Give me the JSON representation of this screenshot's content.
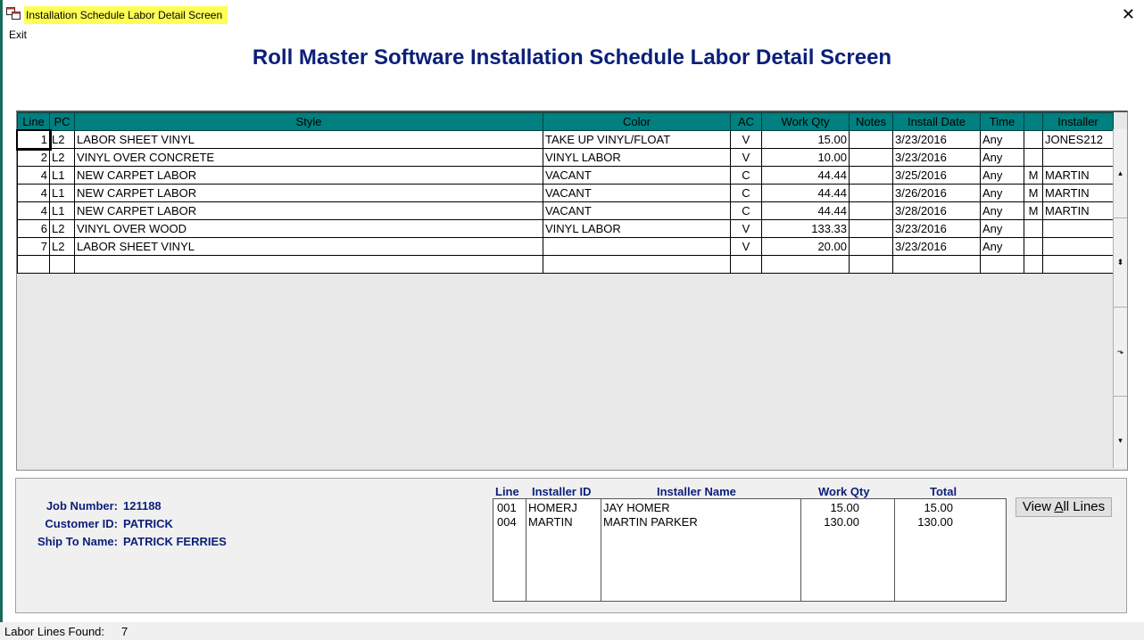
{
  "window": {
    "title": "Installation Schedule Labor Detail Screen",
    "close_glyph": "✕",
    "icon": "app-window-icon"
  },
  "menu": {
    "exit_label": "Exit"
  },
  "heading": "Roll Master Software Installation Schedule Labor Detail Screen",
  "grid": {
    "columns": [
      "Line",
      "PC",
      "Style",
      "Color",
      "AC",
      "Work Qty",
      "Notes",
      "Install Date",
      "Time",
      "",
      "Installer"
    ],
    "rows": [
      [
        "1",
        "L2",
        " LABOR SHEET VINYL",
        "TAKE UP VINYL/FLOAT",
        "V",
        "15.00",
        "",
        "3/23/2016",
        "Any",
        "",
        "JONES212"
      ],
      [
        "2",
        "L2",
        "VINYL OVER CONCRETE",
        "VINYL LABOR",
        "V",
        "10.00",
        "",
        "3/23/2016",
        "Any",
        "",
        ""
      ],
      [
        "4",
        "L1",
        "NEW CARPET LABOR",
        "VACANT",
        "C",
        "44.44",
        "",
        "3/25/2016",
        "Any",
        "M",
        "MARTIN"
      ],
      [
        "4",
        "L1",
        "NEW CARPET LABOR",
        "VACANT",
        "C",
        "44.44",
        "",
        "3/26/2016",
        "Any",
        "M",
        "MARTIN"
      ],
      [
        "4",
        "L1",
        "NEW CARPET LABOR",
        "VACANT",
        "C",
        "44.44",
        "",
        "3/28/2016",
        "Any",
        "M",
        "MARTIN"
      ],
      [
        "6",
        "L2",
        "VINYL OVER WOOD",
        "VINYL LABOR",
        "V",
        "133.33",
        "",
        "3/23/2016",
        "Any",
        "",
        ""
      ],
      [
        "7",
        "L2",
        " LABOR SHEET VINYL",
        "",
        "V",
        "20.00",
        "",
        "3/23/2016",
        "Any",
        "",
        ""
      ],
      [
        "",
        "",
        "",
        "",
        "",
        "",
        "",
        "",
        "",
        "",
        ""
      ]
    ],
    "scroll_glyphs": [
      "▴",
      "⬍",
      "⬎",
      "▾"
    ]
  },
  "job": {
    "job_number_label": "Job Number:",
    "job_number": "121188",
    "customer_id_label": "Customer ID:",
    "customer_id": "PATRICK",
    "ship_to_label": "Ship To Name:",
    "ship_to": "PATRICK FERRIES"
  },
  "summary": {
    "headers": [
      "Line",
      "Installer ID",
      "Installer Name",
      "Work Qty",
      "Total"
    ],
    "rows": [
      [
        "001",
        "HOMERJ",
        "JAY HOMER",
        "15.00",
        "15.00"
      ],
      [
        "004",
        "MARTIN",
        "MARTIN PARKER",
        "130.00",
        "130.00"
      ]
    ]
  },
  "view_all_button": "View All Lines",
  "status": {
    "label": "Labor Lines Found:",
    "value": "7"
  }
}
